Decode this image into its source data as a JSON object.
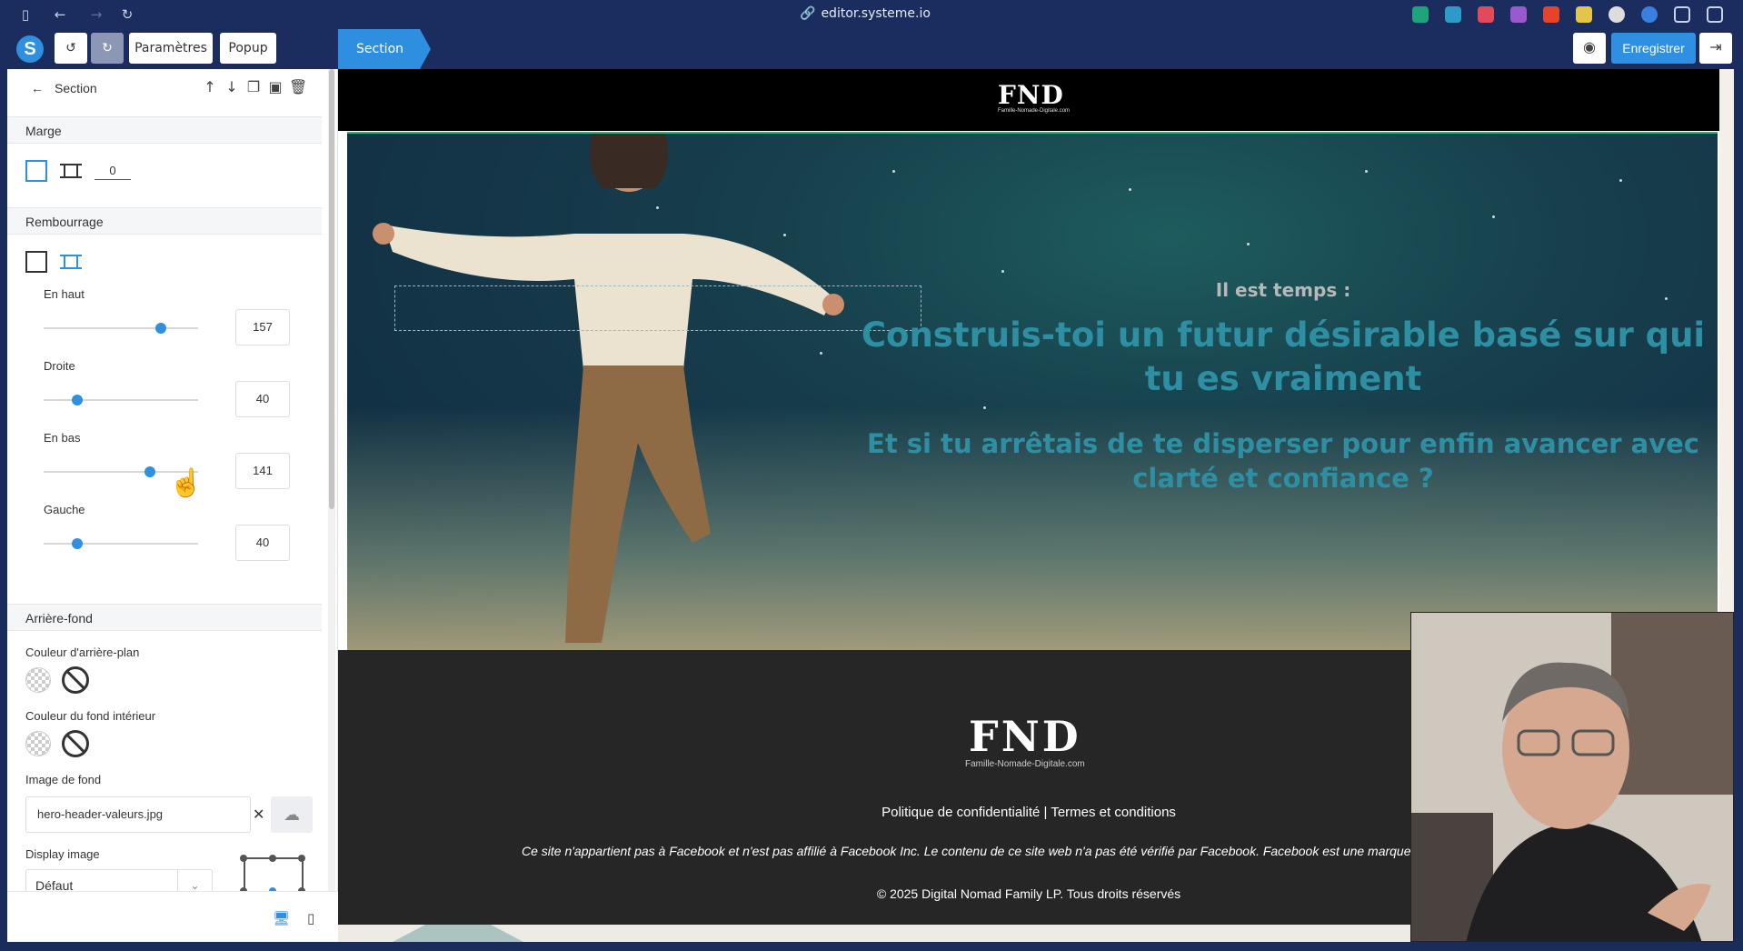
{
  "browser": {
    "url": "editor.systeme.io"
  },
  "toolbar": {
    "params_label": "Paramètres",
    "popup_label": "Popup",
    "section_tab": "Section",
    "save_label": "Enregistrer"
  },
  "panel": {
    "title": "Section",
    "margin": {
      "heading": "Marge",
      "value": "0"
    },
    "padding": {
      "heading": "Rembourrage",
      "top": {
        "label": "En haut",
        "value": "157",
        "fraction": 0.76
      },
      "right": {
        "label": "Droite",
        "value": "40",
        "fraction": 0.22
      },
      "bottom": {
        "label": "En bas",
        "value": "141",
        "fraction": 0.69
      },
      "left": {
        "label": "Gauche",
        "value": "40",
        "fraction": 0.22
      }
    },
    "background": {
      "heading": "Arrière-fond",
      "bg_color_label": "Couleur d'arrière-plan",
      "inner_color_label": "Couleur du fond intérieur",
      "image_label": "Image de fond",
      "image_file": "hero-header-valeurs.jpg",
      "display_label": "Display image",
      "display_value": "Défaut"
    }
  },
  "site": {
    "logo_text": "FND",
    "logo_sub": "Famille-Nomade-Digitale.com",
    "hero": {
      "eyebrow": "Il est temps :",
      "headline": "Construis-toi un futur désirable basé sur qui tu es vraiment",
      "subhead": "Et si tu arrêtais de te disperser pour enfin avancer avec clarté et confiance ?"
    },
    "footer": {
      "links": "Politique de confidentialité | Termes et conditions",
      "disclaimer": "Ce site n'appartient pas à Facebook et n'est pas affilié à Facebook Inc. Le contenu de ce site web n'a pas été vérifié par Facebook. Facebook est une marque dép",
      "copyright": "© 2025 Digital Nomad Family LP. Tous droits réservés"
    }
  },
  "colors": {
    "accent": "#2f8fe0",
    "chrome": "#1b2d5e",
    "hero_text": "#2f8fa2",
    "footer_bg": "#262626"
  }
}
